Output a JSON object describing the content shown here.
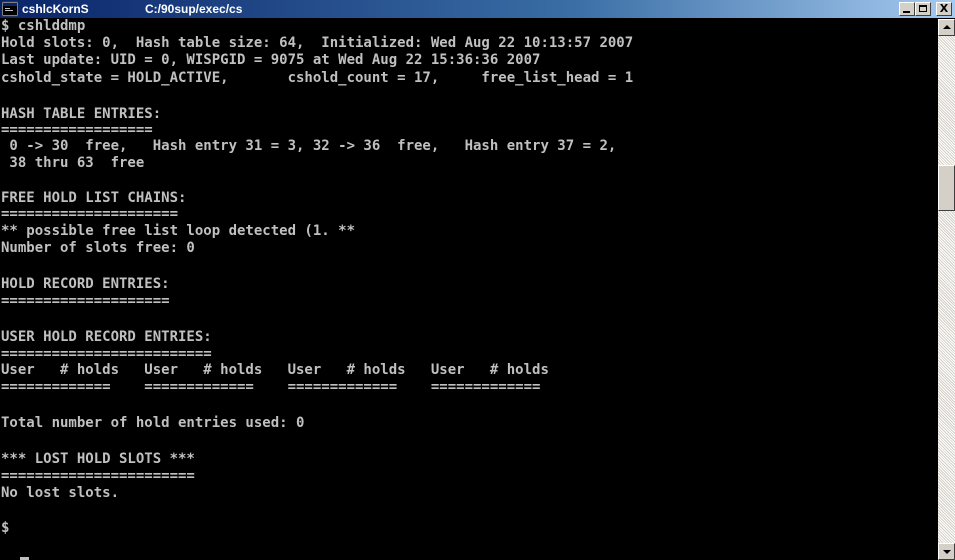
{
  "window": {
    "title": "cshlcKornS",
    "path": "C:/90sup/exec/cs",
    "icon": "console-icon",
    "controls": {
      "minimize": "_",
      "maximize": "□",
      "close": "X"
    }
  },
  "console": {
    "lines": [
      "$ cshlddmp",
      "Hold slots: 0,  Hash table size: 64,  Initialized: Wed Aug 22 10:13:57 2007",
      "Last update: UID = 0, WISPGID = 9075 at Wed Aug 22 15:36:36 2007",
      "cshold_state = HOLD_ACTIVE,       cshold_count = 17,     free_list_head = 1",
      "",
      "HASH TABLE ENTRIES:",
      "==================",
      " 0 -> 30  free,   Hash entry 31 = 3, 32 -> 36  free,   Hash entry 37 = 2,",
      " 38 thru 63  free",
      "",
      "FREE HOLD LIST CHAINS:",
      "=====================",
      "** possible free list loop detected (1. **",
      "Number of slots free: 0",
      "",
      "HOLD RECORD ENTRIES:",
      "====================",
      "",
      "USER HOLD RECORD ENTRIES:",
      "=========================",
      "User   # holds   User   # holds   User   # holds   User   # holds",
      "=============    =============    =============    =============",
      "",
      "Total number of hold entries used: 0",
      "",
      "*** LOST HOLD SLOTS ***",
      "=======================",
      "No lost slots.",
      "",
      "$ "
    ],
    "colors": {
      "background": "#000000",
      "foreground": "#c0c0c0"
    }
  }
}
